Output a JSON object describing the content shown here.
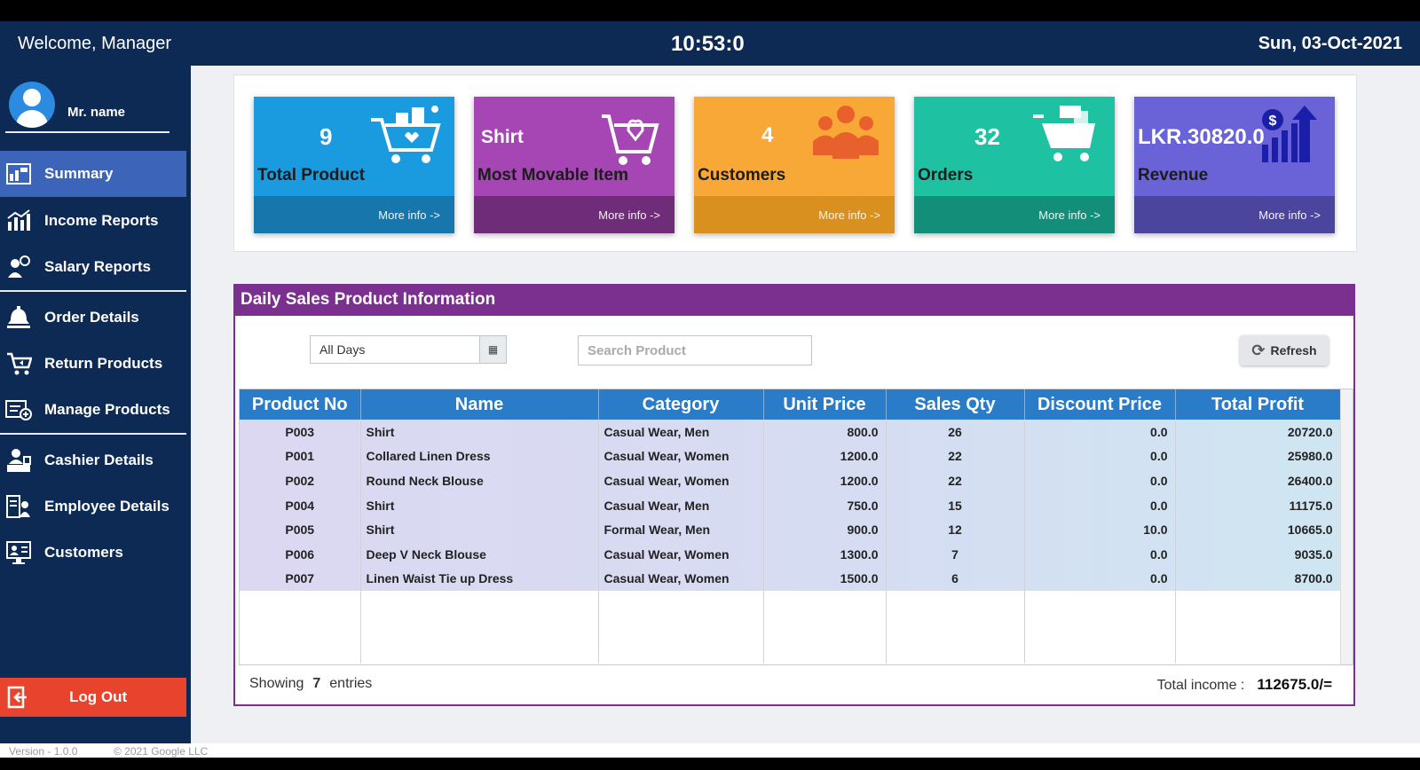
{
  "topbar": {
    "welcome": "Welcome, Manager",
    "clock": "10:53:0",
    "date": "Sun, 03-Oct-2021"
  },
  "sidebar": {
    "user_name": "Mr. name",
    "items": [
      {
        "label": "Summary",
        "icon": "chart-panel-icon",
        "active": true
      },
      {
        "label": "Income Reports",
        "icon": "bar-chart-icon"
      },
      {
        "label": "Salary Reports",
        "icon": "salary-person-icon"
      },
      {
        "label": "Order Details",
        "icon": "bell-icon"
      },
      {
        "label": "Return Products",
        "icon": "return-cart-icon"
      },
      {
        "label": "Manage Products",
        "icon": "manage-box-icon"
      },
      {
        "label": "Cashier Details",
        "icon": "cashier-icon"
      },
      {
        "label": "Employee Details",
        "icon": "employee-icon"
      },
      {
        "label": "Customers",
        "icon": "customers-icon"
      }
    ],
    "logout_label": "Log Out"
  },
  "cards": [
    {
      "value": "9",
      "label": "Total Product",
      "more": "More info ->",
      "color": "#1a9be0",
      "footer_color": "#1777ad",
      "icon": "cart-icon"
    },
    {
      "value": "Shirt",
      "label": "Most Movable Item",
      "more": "More info ->",
      "color": "#a646b5",
      "footer_color": "#6f2c78",
      "icon": "heart-cart-icon"
    },
    {
      "value": "4",
      "label": "Customers",
      "more": "More info ->",
      "color": "#f7a836",
      "footer_color": "#d9901e",
      "icon": "people-icon"
    },
    {
      "value": "32",
      "label": "Orders",
      "more": "More info ->",
      "color": "#1fc1a3",
      "footer_color": "#138e78",
      "icon": "shopping-cart-icon"
    },
    {
      "value": "LKR.30820.0",
      "label": "Revenue",
      "more": "More info ->",
      "color": "#6a63d8",
      "footer_color": "#4b459e",
      "icon": "revenue-chart-icon"
    }
  ],
  "sales": {
    "title": "Daily Sales Product Information",
    "filter_value": "All Days",
    "search_placeholder": "Search Product",
    "refresh_label": "Refresh",
    "columns": [
      "Product No",
      "Name",
      "Category",
      "Unit Price",
      "Sales Qty",
      "Discount Price",
      "Total Profit"
    ],
    "rows": [
      [
        "P003",
        "Shirt",
        "Casual Wear, Men",
        "800.0",
        "26",
        "0.0",
        "20720.0"
      ],
      [
        "P001",
        "Collared Linen Dress",
        "Casual Wear, Women",
        "1200.0",
        "22",
        "0.0",
        "25980.0"
      ],
      [
        "P002",
        "Round Neck Blouse",
        "Casual Wear, Women",
        "1200.0",
        "22",
        "0.0",
        "26400.0"
      ],
      [
        "P004",
        "Shirt",
        "Casual Wear, Men",
        "750.0",
        "15",
        "0.0",
        "11175.0"
      ],
      [
        "P005",
        "Shirt",
        "Formal Wear, Men",
        "900.0",
        "12",
        "10.0",
        "10665.0"
      ],
      [
        "P006",
        "Deep V Neck Blouse",
        "Casual Wear, Women",
        "1300.0",
        "7",
        "0.0",
        "9035.0"
      ],
      [
        "P007",
        "Linen Waist Tie up Dress",
        "Casual Wear, Women",
        "1500.0",
        "6",
        "0.0",
        "8700.0"
      ]
    ],
    "showing_prefix": "Showing",
    "showing_count": "7",
    "showing_suffix": "entries",
    "income_label": "Total income :",
    "income_value": "112675.0/="
  },
  "footer": {
    "version": "Version - 1.0.0",
    "copyright": "© 2021 Google LLC"
  }
}
